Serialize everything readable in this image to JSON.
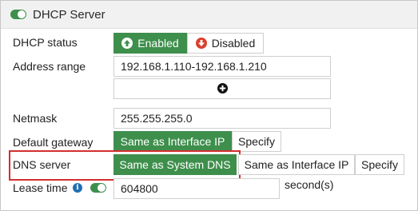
{
  "header": {
    "title": "DHCP Server"
  },
  "dhcp_status": {
    "label": "DHCP status",
    "enabled_label": "Enabled",
    "disabled_label": "Disabled"
  },
  "address_range": {
    "label": "Address range",
    "value": "192.168.1.110-192.168.1.210"
  },
  "netmask": {
    "label": "Netmask",
    "value": "255.255.255.0"
  },
  "default_gateway": {
    "label": "Default gateway",
    "options": [
      "Same as Interface IP",
      "Specify"
    ]
  },
  "dns_server": {
    "label": "DNS server",
    "options": [
      "Same as System DNS",
      "Same as Interface IP",
      "Specify"
    ]
  },
  "lease_time": {
    "label": "Lease time",
    "value": "604800",
    "unit": "second(s)"
  },
  "colors": {
    "accent": "#3e8f4c",
    "highlight": "#d32f2f",
    "info": "#1f6fb2"
  }
}
